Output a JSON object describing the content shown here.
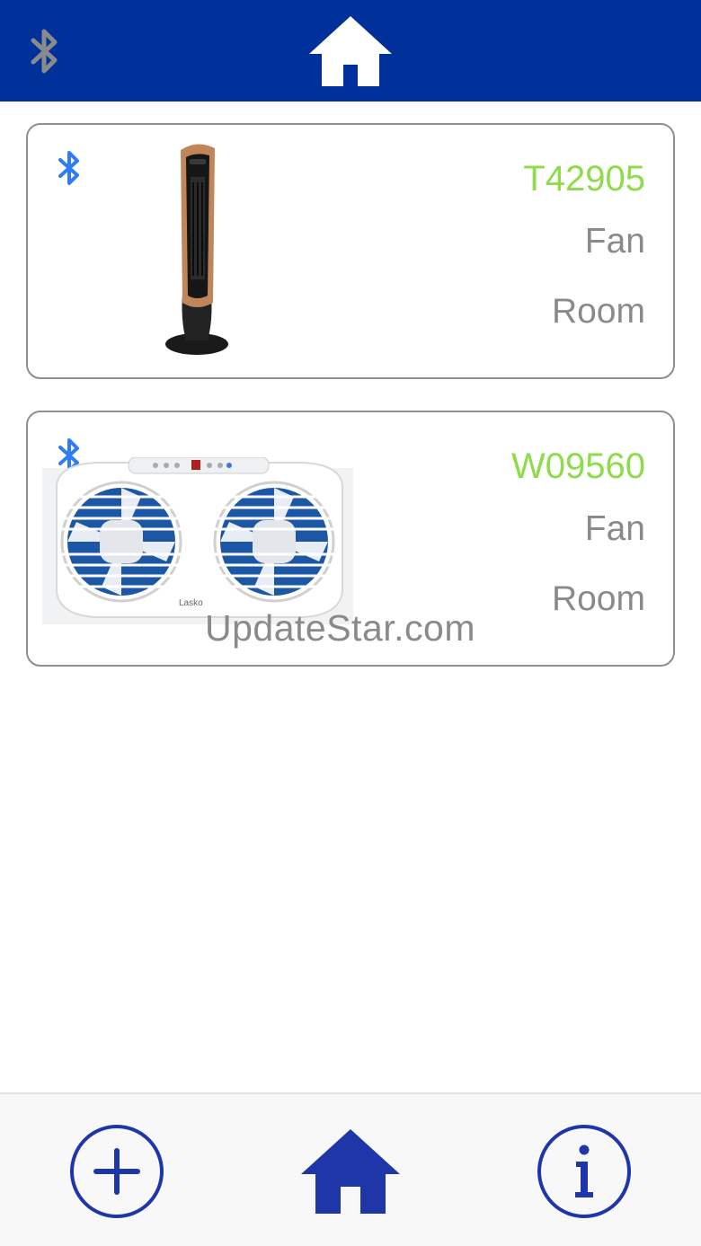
{
  "header": {
    "bluetooth_icon": "bluetooth-icon",
    "home_icon": "home-icon",
    "bar_color": "#00309a",
    "bluetooth_color": "#8a8a8a"
  },
  "devices": [
    {
      "model": "T42905",
      "type": "Fan",
      "room": "Room",
      "image": "tower-fan",
      "bluetooth_icon": "bluetooth-icon"
    },
    {
      "model": "W09560",
      "type": "Fan",
      "room": "Room",
      "image": "window-fan",
      "image_brand": "Lasko",
      "bluetooth_icon": "bluetooth-icon"
    }
  ],
  "watermark": "UpdateStar.com",
  "tabbar": {
    "items": [
      {
        "icon": "add-circle-icon"
      },
      {
        "icon": "home-icon"
      },
      {
        "icon": "info-circle-icon"
      }
    ],
    "icon_color": "#1f36a8"
  },
  "colors": {
    "model_text": "#8edc4c",
    "secondary_text": "#8a8a8a",
    "bluetooth_blue": "#2f7cf6"
  }
}
